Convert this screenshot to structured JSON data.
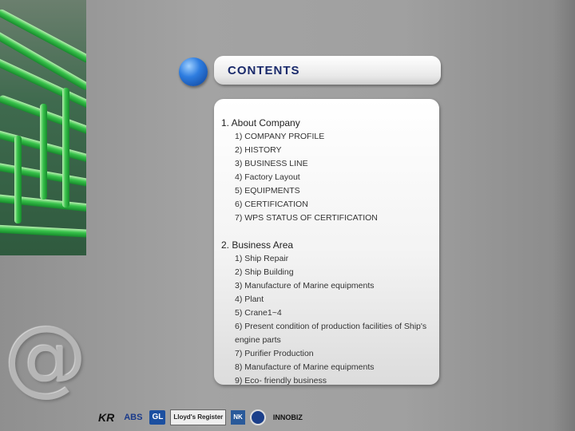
{
  "header": {
    "title": "CONTENTS"
  },
  "sections": [
    {
      "title": "1. About Company",
      "items": [
        "1) COMPANY PROFILE",
        "2) HISTORY",
        "3) BUSINESS LINE",
        "4) Factory Layout",
        "5) EQUIPMENTS",
        "6) CERTIFICATION",
        "7) WPS STATUS OF CERTIFICATION"
      ]
    },
    {
      "title": "2. Business Area",
      "items": [
        "1) Ship Repair",
        "2) Ship Building",
        "3) Manufacture of  Marine  equipments",
        "4) Plant",
        "5) Crane1~4",
        "6) Present  condition of production facilities  of  Ship's",
        "engine  parts",
        "7) Purifier Production",
        "8) Manufacture of Marine equipments",
        "9) Eco- friendly  business"
      ]
    }
  ],
  "footer": {
    "logos": {
      "kr": "KR",
      "abs": "ABS",
      "gl": "GL",
      "lr": "Lloyd's Register",
      "nk": "NK",
      "inno": "INNOBIZ"
    }
  },
  "decor": {
    "at_sign": "@"
  }
}
